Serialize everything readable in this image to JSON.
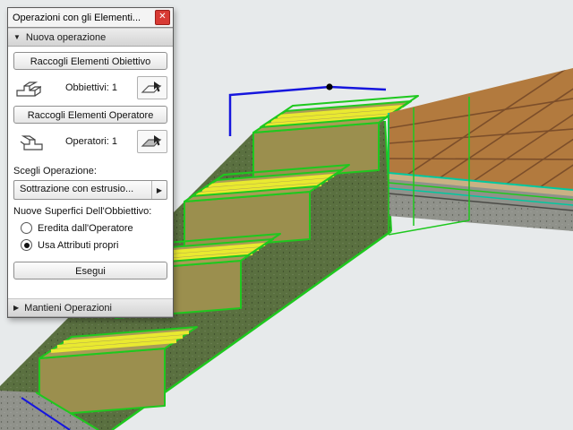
{
  "window": {
    "title": "Operazioni con gli Elementi...",
    "close_glyph": "✕"
  },
  "icons": {
    "expander_expanded": "▼",
    "expander_collapsed": "▶",
    "dropdown_arrow": "▶",
    "target_elements_icon": "axonometric-step-wireframe",
    "operator_elements_icon": "axonometric-step-wireframe",
    "pick_target_icon": "cursor-over-plane",
    "pick_operator_icon": "cursor-over-plane"
  },
  "sections": {
    "new_operation": "Nuova operazione",
    "keep_operations": "Mantieni Operazioni"
  },
  "buttons": {
    "collect_targets": "Raccogli Elementi Obiettivo",
    "collect_operators": "Raccogli Elementi Operatore",
    "execute": "Esegui"
  },
  "counters": {
    "targets": "Obbiettivi: 1",
    "operators": "Operatori: 1"
  },
  "operation": {
    "choose_label": "Scegli Operazione:",
    "selected": "Sottrazione con estrusio..."
  },
  "surfaces": {
    "label": "Nuove Superfici Dell'Obbiettivo:",
    "options": [
      {
        "label": "Eredita dall'Operatore",
        "selected": false
      },
      {
        "label": "Usa Attributi propri",
        "selected": true
      }
    ]
  },
  "scene": {
    "description": "3D axonometric view of a staircase selected (green) meeting a tiled floor slab",
    "colors": {
      "background": "#e7eaeb",
      "selection_green": "#1ec81e",
      "selection_blue": "#1616dd",
      "slab_teal": "#00c8a0",
      "tile_brown": "#b27a3e",
      "tile_grout": "#7c4e2a",
      "stringer_green": "#5a7040",
      "concrete_gray": "#90928b",
      "tread_tan": "#a99b56",
      "riser_tan": "#9b8f4e",
      "stripe_yellow": "#e9e930",
      "layer_tan": "#c9b184"
    }
  }
}
